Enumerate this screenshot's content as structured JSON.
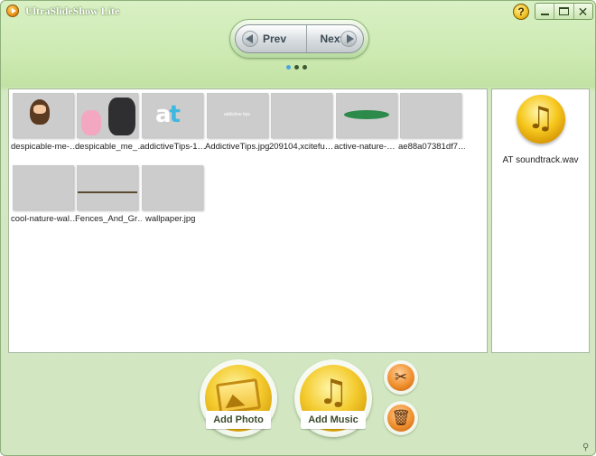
{
  "window": {
    "title": "UltraSlideShow Lite",
    "help_glyph": "?",
    "minimize_icon": "minimize-icon",
    "maximize_icon": "maximize-icon",
    "close_glyph": "✕"
  },
  "nav": {
    "prev_label": "Prev",
    "next_label": "Next",
    "page_count": 3,
    "active_page": 1
  },
  "photos": [
    {
      "caption": "despicable-me-…"
    },
    {
      "caption": "despicable_me_…"
    },
    {
      "caption": "addictiveTips-1…"
    },
    {
      "caption": "AddictiveTips.jpg"
    },
    {
      "caption": "209104,xcitefu…"
    },
    {
      "caption": "active-nature-…"
    },
    {
      "caption": "ae88a07381df7…"
    },
    {
      "caption": "cool-nature-wal…"
    },
    {
      "caption": "Fences_And_Gr…"
    },
    {
      "caption": "wallpaper.jpg"
    }
  ],
  "thumb_logo": {
    "a": "a",
    "t": "t"
  },
  "music": {
    "file": "AT soundtrack.wav",
    "icon": "music-note-icon",
    "glyph": "♫"
  },
  "actions": {
    "add_photo": "Add Photo",
    "add_music": "Add Music",
    "settings_icon": "tools-icon",
    "settings_glyph": "✂",
    "delete_icon": "trash-icon",
    "delete_glyph": "🗑",
    "music_glyph": "♫"
  },
  "colors": {
    "accent_active_dot": "#4aa6e0",
    "background": "#d2e6c2",
    "gold": "#f4cc30",
    "orange": "#f0902e"
  }
}
